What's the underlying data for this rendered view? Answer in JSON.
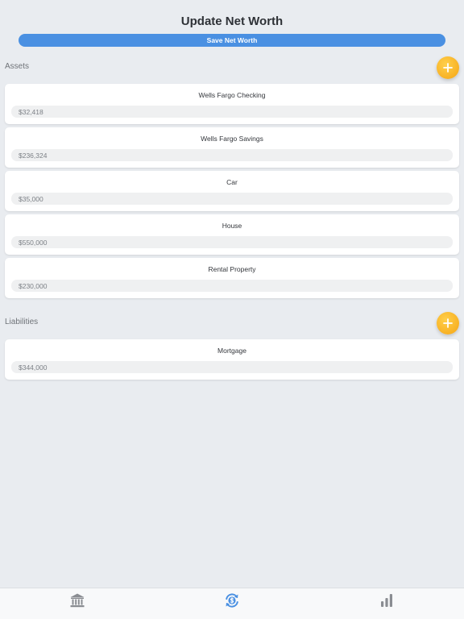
{
  "header": {
    "title": "Update Net Worth",
    "save_label": "Save Net Worth"
  },
  "colors": {
    "accent": "#4a90e2",
    "add_button": "#f5a515",
    "background": "#e9ecf0",
    "tab_inactive": "#8a8d92"
  },
  "assets": {
    "label": "Assets",
    "add_icon": "plus-icon",
    "items": [
      {
        "name": "Wells Fargo Checking",
        "value": "$32,418"
      },
      {
        "name": "Wells Fargo Savings",
        "value": "$236,324"
      },
      {
        "name": "Car",
        "value": "$35,000"
      },
      {
        "name": "House",
        "value": "$550,000"
      },
      {
        "name": "Rental Property",
        "value": "$230,000"
      }
    ]
  },
  "liabilities": {
    "label": "Liabilities",
    "add_icon": "plus-icon",
    "items": [
      {
        "name": "Mortgage",
        "value": "$344,000"
      }
    ]
  },
  "tab_bar": {
    "tabs": [
      {
        "icon": "bank-icon",
        "active": false
      },
      {
        "icon": "dollar-sync-icon",
        "active": true
      },
      {
        "icon": "bar-chart-icon",
        "active": false
      }
    ]
  }
}
